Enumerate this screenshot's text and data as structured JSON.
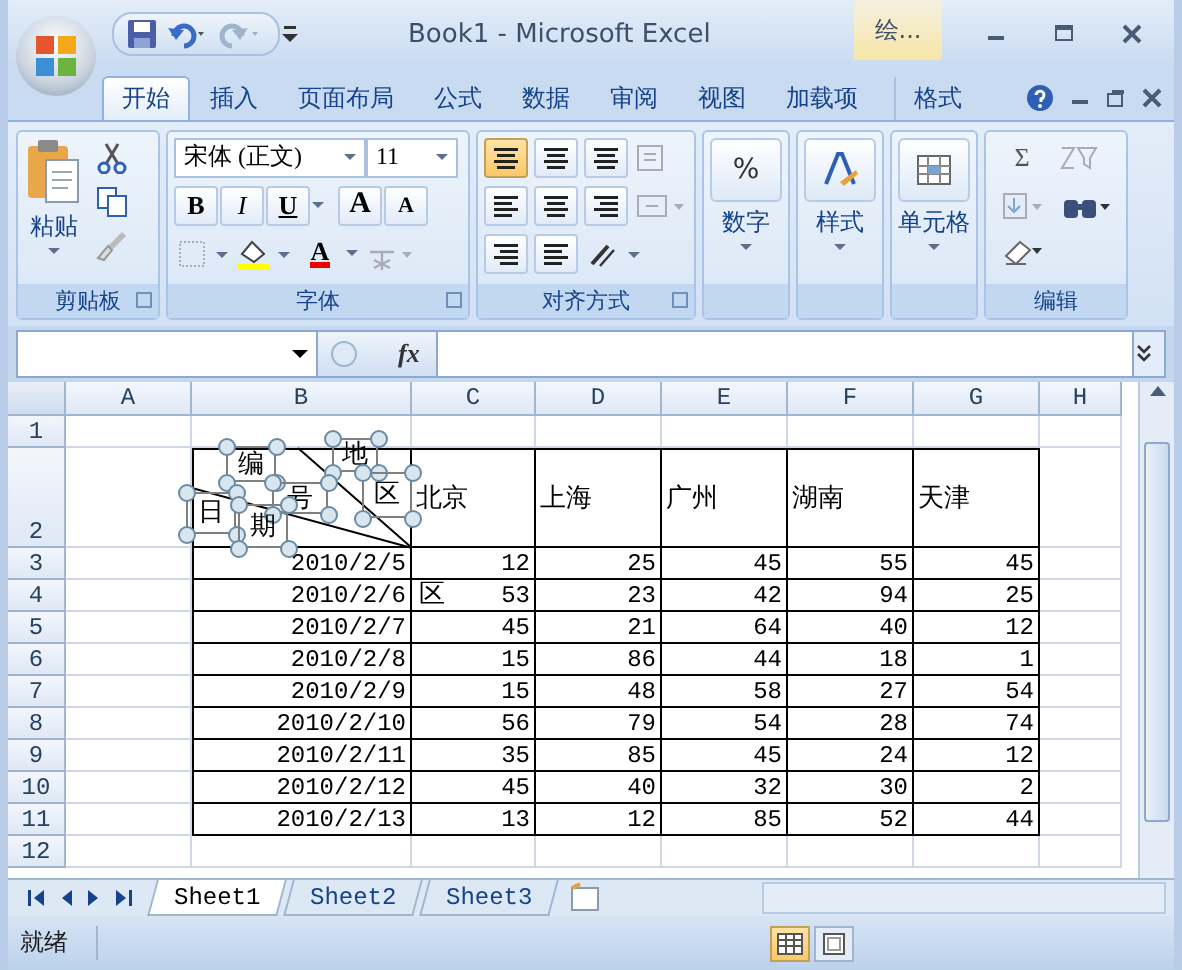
{
  "title_bar": {
    "title": "Book1 - Microsoft Excel",
    "context_tab": "绘..."
  },
  "ribbon_tabs": [
    {
      "label": "开始",
      "selected": true
    },
    {
      "label": "插入",
      "selected": false
    },
    {
      "label": "页面布局",
      "selected": false
    },
    {
      "label": "公式",
      "selected": false
    },
    {
      "label": "数据",
      "selected": false
    },
    {
      "label": "审阅",
      "selected": false
    },
    {
      "label": "视图",
      "selected": false
    },
    {
      "label": "加载项",
      "selected": false
    },
    {
      "label": "格式",
      "selected": false
    }
  ],
  "ribbon": {
    "clipboard": {
      "paste": "粘贴",
      "group": "剪贴板"
    },
    "font": {
      "font_name": "宋体 (正文)",
      "font_size": "11",
      "bold": "B",
      "italic": "I",
      "underline": "U",
      "grow": "A",
      "shrink": "A",
      "font_color": "A",
      "group": "字体"
    },
    "alignment": {
      "group": "对齐方式"
    },
    "number": {
      "label": "数字",
      "symbol": "%"
    },
    "styles": {
      "label": "样式"
    },
    "cells": {
      "label": "单元格"
    },
    "editing": {
      "sum": "Σ",
      "group": "编辑"
    }
  },
  "formula_bar": {
    "function_label": "fx"
  },
  "sheet": {
    "columns": [
      "A",
      "B",
      "C",
      "D",
      "E",
      "F",
      "G",
      "H"
    ],
    "rows": [
      {
        "header": "1",
        "bordered": false,
        "cells": []
      },
      {
        "header": "2",
        "bordered": true,
        "cells": [
          "",
          "",
          "北京",
          "上海",
          "广州",
          "湖南",
          "天津"
        ]
      },
      {
        "header": "3",
        "bordered": true,
        "cells": [
          "",
          "2010/2/5",
          "12",
          "25",
          "45",
          "55",
          "45"
        ]
      },
      {
        "header": "4",
        "bordered": true,
        "cells": [
          "",
          "2010/2/6",
          "53",
          "23",
          "42",
          "94",
          "25"
        ]
      },
      {
        "header": "5",
        "bordered": true,
        "cells": [
          "",
          "2010/2/7",
          "45",
          "21",
          "64",
          "40",
          "12"
        ]
      },
      {
        "header": "6",
        "bordered": true,
        "cells": [
          "",
          "2010/2/8",
          "15",
          "86",
          "44",
          "18",
          "1"
        ]
      },
      {
        "header": "7",
        "bordered": true,
        "cells": [
          "",
          "2010/2/9",
          "15",
          "48",
          "58",
          "27",
          "54"
        ]
      },
      {
        "header": "8",
        "bordered": true,
        "cells": [
          "",
          "2010/2/10",
          "56",
          "79",
          "54",
          "28",
          "74"
        ]
      },
      {
        "header": "9",
        "bordered": true,
        "cells": [
          "",
          "2010/2/11",
          "35",
          "85",
          "45",
          "24",
          "12"
        ]
      },
      {
        "header": "10",
        "bordered": true,
        "cells": [
          "",
          "2010/2/12",
          "45",
          "40",
          "32",
          "30",
          "2"
        ]
      },
      {
        "header": "11",
        "bordered": true,
        "cells": [
          "",
          "2010/2/13",
          "13",
          "12",
          "85",
          "52",
          "44"
        ]
      },
      {
        "header": "12",
        "bordered": false,
        "cells": []
      }
    ],
    "text_boxes": [
      {
        "text": "编",
        "selected": true
      },
      {
        "text": "地",
        "selected": true
      },
      {
        "text": "号",
        "selected": true
      },
      {
        "text": "区",
        "selected": true
      },
      {
        "text": "日",
        "selected": true
      },
      {
        "text": "期",
        "selected": true
      },
      {
        "text": "区",
        "selected": false
      }
    ]
  },
  "sheet_tabs": [
    {
      "label": "Sheet1",
      "selected": true
    },
    {
      "label": "Sheet2",
      "selected": false
    },
    {
      "label": "Sheet3",
      "selected": false
    }
  ],
  "status_bar": {
    "text": "就绪",
    "views": [
      {
        "kind": "normal",
        "selected": true
      },
      {
        "kind": "layout",
        "selected": false
      }
    ]
  }
}
